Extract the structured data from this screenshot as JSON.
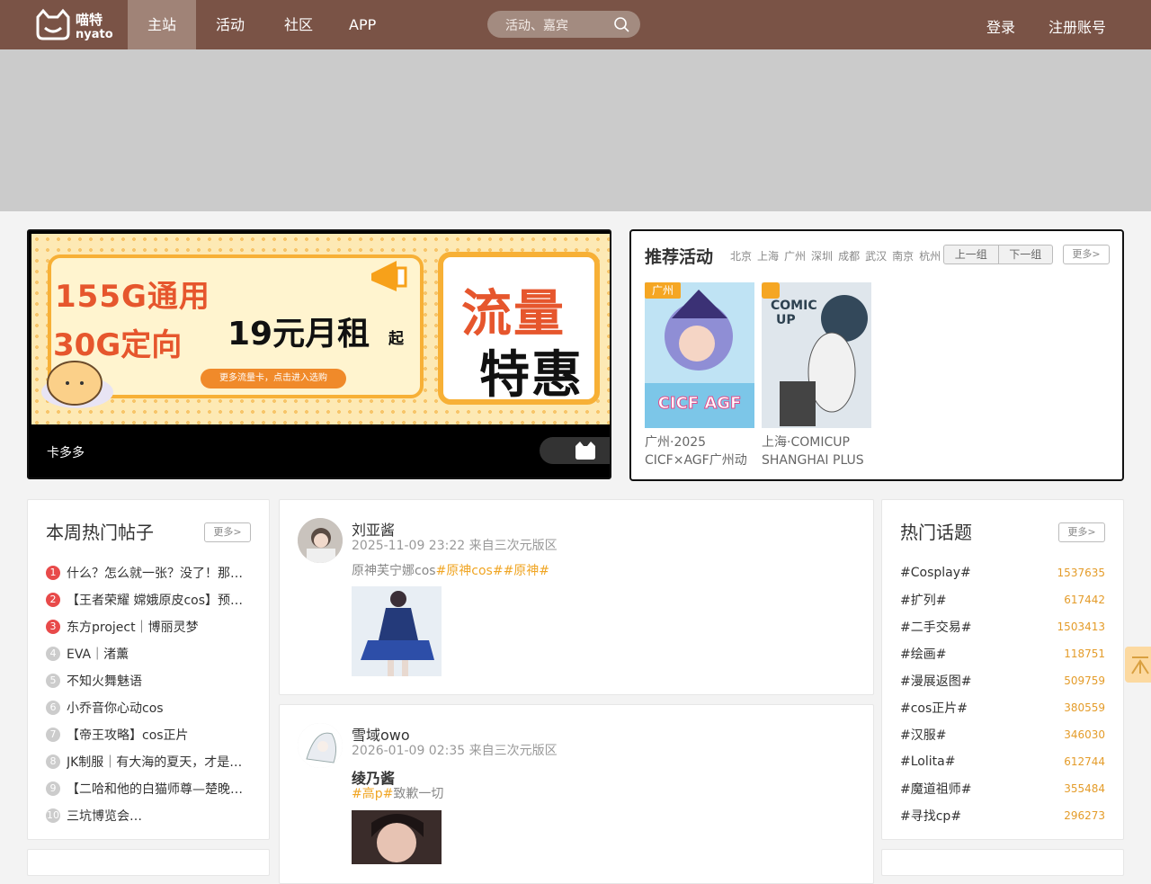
{
  "header": {
    "logo_text": "喵特 nyato",
    "nav": [
      {
        "label": "主站",
        "active": true
      },
      {
        "label": "活动",
        "active": false
      },
      {
        "label": "社区",
        "active": false
      },
      {
        "label": "APP",
        "active": false
      }
    ],
    "search_placeholder": "活动、嘉宾",
    "login": "登录",
    "register": "注册账号"
  },
  "promo": {
    "line1": "155G通用",
    "line2": "30G定向",
    "price": "19元月租",
    "price_suffix": "起",
    "pill": "更多流量卡，点击进入选购",
    "big1": "流量",
    "big2": "特惠",
    "caption": "卡多多"
  },
  "recommend": {
    "title": "推荐活动",
    "cities": [
      "北京",
      "上海",
      "广州",
      "深圳",
      "成都",
      "武汉",
      "南京",
      "杭州"
    ],
    "prev": "上一组",
    "next": "下一组",
    "more": "更多>",
    "events": [
      {
        "tag": "广州",
        "name": "广州·2025 CICF×AGF广州动",
        "poster_text": "CICF AGF"
      },
      {
        "tag": "",
        "name": "上海·COMICUP SHANGHAI PLUS",
        "poster_text": "COMIC UP"
      }
    ]
  },
  "hot_posts": {
    "title": "本周热门帖子",
    "more": "更多>",
    "items": [
      {
        "rank": "1",
        "text": "什么？怎么就一张？没了！那…"
      },
      {
        "rank": "2",
        "text": "【王者荣耀 嫦娥原皮cos】预…"
      },
      {
        "rank": "3",
        "text": "东方project｜博丽灵梦"
      },
      {
        "rank": "4",
        "text": "EVA｜渚薰"
      },
      {
        "rank": "5",
        "text": "不知火舞魅语"
      },
      {
        "rank": "6",
        "text": "小乔音你心动cos"
      },
      {
        "rank": "7",
        "text": "【帝王攻略】cos正片"
      },
      {
        "rank": "8",
        "text": "JK制服｜有大海的夏天，才是…"
      },
      {
        "rank": "9",
        "text": "【二哈和他的白猫师尊—楚晚…"
      },
      {
        "rank": "10",
        "text": "三坑博览会…"
      }
    ]
  },
  "posts": [
    {
      "user": "刘亚酱",
      "meta": "2025-11-09 23:22 来自三次元版区",
      "text_plain": "原神芙宁娜cos",
      "tags": "#原神cos##原神#"
    },
    {
      "user": "雪域owo",
      "meta": "2026-01-09 02:35 来自三次元版区",
      "title": "绫乃酱",
      "tag": "#高p#",
      "text_plain": "致歉一切"
    }
  ],
  "topics": {
    "title": "热门话题",
    "more": "更多>",
    "items": [
      {
        "name": "#Cosplay#",
        "count": "1537635"
      },
      {
        "name": "#扩列#",
        "count": "617442"
      },
      {
        "name": "#二手交易#",
        "count": "1503413"
      },
      {
        "name": "#绘画#",
        "count": "118751"
      },
      {
        "name": "#漫展返图#",
        "count": "509759"
      },
      {
        "name": "#cos正片#",
        "count": "380559"
      },
      {
        "name": "#汉服#",
        "count": "346030"
      },
      {
        "name": "#Lolita#",
        "count": "612744"
      },
      {
        "name": "#魔道祖师#",
        "count": "355484"
      },
      {
        "name": "#寻找cp#",
        "count": "296273"
      }
    ]
  }
}
